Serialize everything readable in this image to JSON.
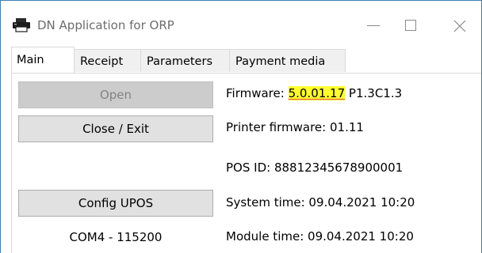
{
  "window": {
    "title": "DN Application for ORP",
    "icon": "printer-icon"
  },
  "tabs": [
    {
      "label": "Main",
      "active": true
    },
    {
      "label": "Receipt",
      "active": false
    },
    {
      "label": "Parameters",
      "active": false
    },
    {
      "label": "Payment media",
      "active": false
    }
  ],
  "buttons": {
    "open": {
      "label": "Open",
      "enabled": false
    },
    "close_exit": {
      "label": "Close / Exit",
      "enabled": true
    },
    "config_upos": {
      "label": "Config UPOS",
      "enabled": true
    }
  },
  "com_port": "COM4 - 115200",
  "info": {
    "firmware_label": "Firmware: ",
    "firmware_version": "5.0.01.17",
    "firmware_suffix": " P1.3C1.3",
    "printer_firmware": "Printer firmware: 01.11",
    "pos_id": "POS ID: 88812345678900001",
    "system_time": "System time: 09.04.2021 10:20",
    "module_time": "Module time: 09.04.2021 10:20"
  },
  "colors": {
    "highlight": "#ffff2e",
    "window_border": "#3c7fb1",
    "button_face": "#e1e1e1",
    "button_disabled": "#cccccc"
  }
}
